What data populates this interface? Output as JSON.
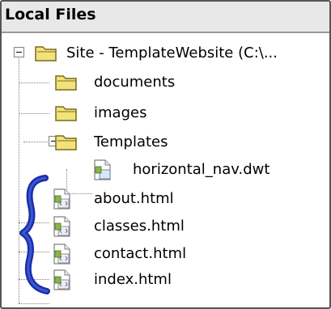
{
  "panel": {
    "title": "Local Files",
    "tree": [
      {
        "label": "Site - TemplateWebsite (C:\\...",
        "icon": "folder-icon",
        "toggle": "minus"
      },
      {
        "label": "documents",
        "icon": "folder-icon"
      },
      {
        "label": "images",
        "icon": "folder-icon"
      },
      {
        "label": "Templates",
        "icon": "folder-icon",
        "toggle": "minus"
      },
      {
        "label": "horizontal_nav.dwt",
        "icon": "template-file-icon"
      },
      {
        "label": "about.html",
        "icon": "html-file-icon"
      },
      {
        "label": "classes.html",
        "icon": "html-file-icon"
      },
      {
        "label": "contact.html",
        "icon": "html-file-icon"
      },
      {
        "label": "index.html",
        "icon": "html-file-icon"
      }
    ]
  },
  "colors": {
    "folder": "#f2e27a",
    "folder_stroke": "#7a6a1a",
    "annotation": "#1b2fa8"
  }
}
